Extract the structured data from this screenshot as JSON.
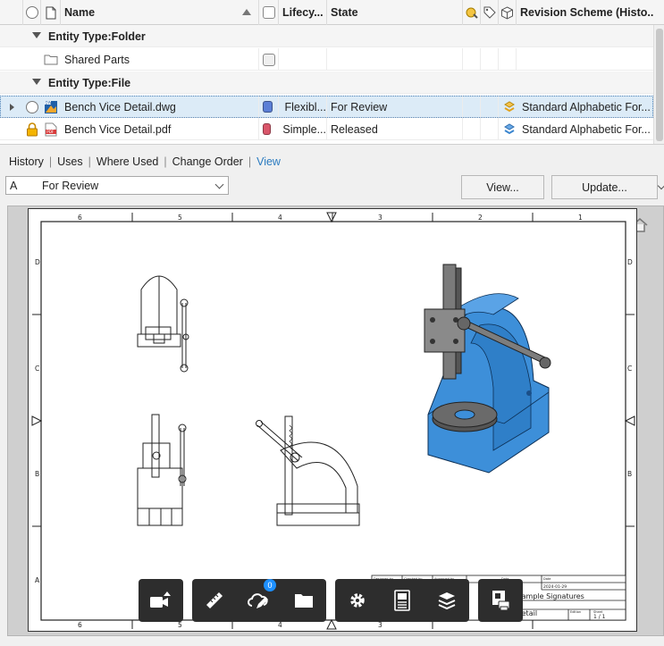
{
  "grid": {
    "columns": {
      "name": "Name",
      "lifecycle": "Lifecy...",
      "state": "State",
      "revision_scheme": "Revision Scheme (Histo..."
    },
    "groups": [
      {
        "label": "Entity Type:Folder"
      },
      {
        "label": "Entity Type:File"
      }
    ],
    "folder_rows": [
      {
        "name": "Shared Parts"
      }
    ],
    "file_rows": [
      {
        "name": "Bench Vice Detail.dwg",
        "lifecycle": "Flexibl...",
        "lifecycle_color": "#5b7fd6",
        "state": "For Review",
        "revision_scheme": "Standard Alphabetic For...",
        "file_type": "DWG",
        "selected": true
      },
      {
        "name": "Bench Vice Detail.pdf",
        "lifecycle": "Simple...",
        "lifecycle_color": "#d9566a",
        "state": "Released",
        "revision_scheme": "Standard Alphabetic For...",
        "file_type": "PDF",
        "locked": true,
        "selected": false
      }
    ]
  },
  "tabs": [
    {
      "label": "History",
      "active": false
    },
    {
      "label": "Uses",
      "active": false
    },
    {
      "label": "Where Used",
      "active": false
    },
    {
      "label": "Change Order",
      "active": false
    },
    {
      "label": "View",
      "active": true
    }
  ],
  "revision": {
    "letter": "A",
    "state": "For Review"
  },
  "buttons": {
    "view": "View...",
    "update": "Update..."
  },
  "drawing": {
    "col_numbers": [
      "6",
      "5",
      "4",
      "3",
      "2",
      "1"
    ],
    "row_letters": [
      "D",
      "C",
      "B",
      "A"
    ],
    "title_block": {
      "title": "...ample Signatures",
      "date": "2024-01-29",
      "sheet": "1 / 1",
      "part": "...etail",
      "labels": [
        "Designed by",
        "Checked by",
        "Approved by",
        "Date",
        "Date",
        "Edition",
        "Sheet"
      ]
    }
  },
  "viewer_toolbar": {
    "markup_badge": "0"
  },
  "colors": {
    "accent": "#2b7bc0",
    "selection": "#dcebf7",
    "part_blue": "#3d8fd9",
    "toolbar": "#2d2d2d"
  }
}
